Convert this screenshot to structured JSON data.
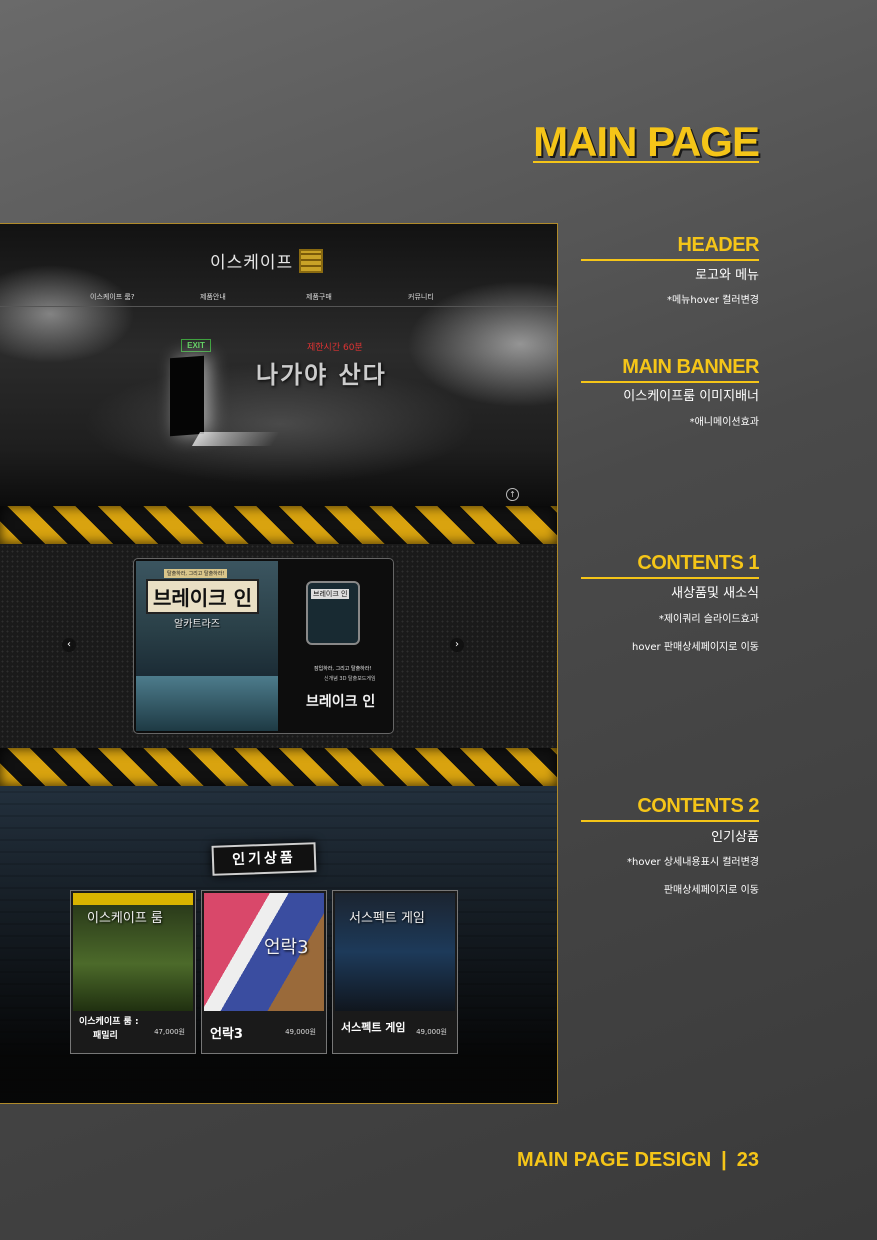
{
  "page_title": "MAIN PAGE",
  "mockup": {
    "logo_text": "이스케이프",
    "nav": [
      "이스케이프 룸?",
      "제품안내",
      "제품구매",
      "커뮤니티"
    ],
    "exit_sign": "EXIT",
    "time_text": "제한시간 60분",
    "tagline": "나가야 산다",
    "slide": {
      "cover_tag": "탈출하라, 그리고 탈출하라!",
      "cover_title": "브레이크 인",
      "cover_sub": "알카트라즈",
      "box_label": "브레이크 인",
      "small_line1": "잠입하라, 그리고 탈출하라!",
      "small_line2": "신개념 3D 탈출보드게임",
      "name": "브레이크 인"
    },
    "popular_title": "인기상품",
    "products": [
      {
        "image_label": "이스케이프 룸",
        "name_line1": "이스케이프 룸 :",
        "name_line2": "패밀리",
        "price": "47,000원"
      },
      {
        "image_label": "언락3",
        "name_line1": "언락3",
        "name_line2": "",
        "price": "49,000원"
      },
      {
        "image_label": "서스펙트 게임",
        "name_line1": "서스펙트 게임",
        "name_line2": "",
        "price": "49,000원"
      }
    ]
  },
  "sections": [
    {
      "title": "HEADER",
      "subtitle": "로고와 메뉴",
      "notes": [
        "*메뉴hover 컬러변경"
      ]
    },
    {
      "title": "MAIN BANNER",
      "subtitle": "이스케이프룸 이미지배너",
      "notes": [
        "*애니메이션효과"
      ]
    },
    {
      "title": "CONTENTS 1",
      "subtitle": "새상품및 새소식",
      "notes": [
        "*제이쿼리 슬라이드효과",
        "hover 판매상세페이지로 이동"
      ]
    },
    {
      "title": "CONTENTS 2",
      "subtitle": "인기상품",
      "notes": [
        "*hover 상세내용표시 컬러변경",
        "판매상세페이지로 이동"
      ]
    }
  ],
  "footer": {
    "label": "MAIN PAGE DESIGN",
    "separator": "|",
    "page_number": "23"
  },
  "colors": {
    "accent": "#f5c518",
    "background": "#4a4a4a",
    "hazard_yellow": "#d9a30f"
  }
}
